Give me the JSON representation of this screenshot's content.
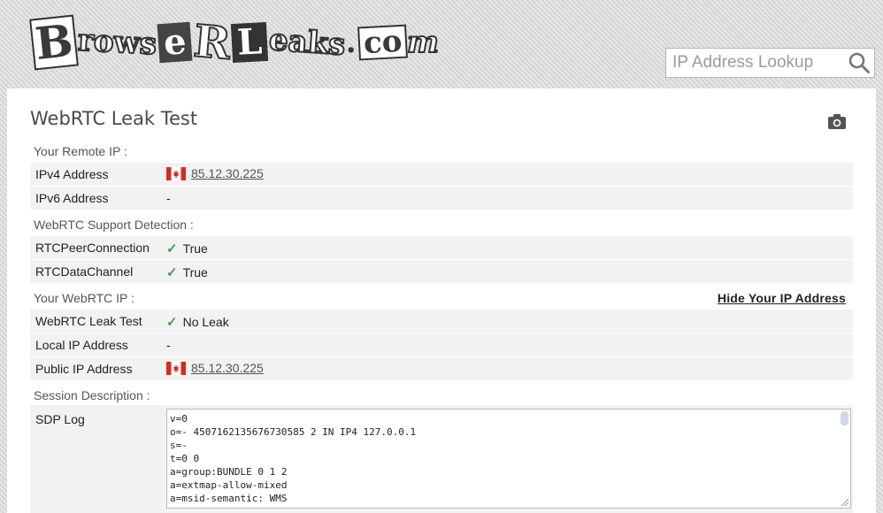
{
  "header": {
    "logo_text": "BrowserLeaks.com",
    "search_placeholder": "IP Address Lookup",
    "search_icon": "magnifier-icon"
  },
  "panel": {
    "title": "WebRTC Leak Test",
    "camera_icon": "camera-icon",
    "sections": {
      "remote_ip": "Your Remote IP :",
      "support": "WebRTC Support Detection :",
      "webrtc_ip": "Your WebRTC IP :",
      "session": "Session Description :"
    },
    "hide_link": "Hide Your IP Address",
    "rows": {
      "ipv4": {
        "label": "IPv4 Address",
        "value": "85.12.30.225",
        "flag": "canada-flag"
      },
      "ipv6": {
        "label": "IPv6 Address",
        "value": "-"
      },
      "peer": {
        "label": "RTCPeerConnection",
        "value": "True"
      },
      "channel": {
        "label": "RTCDataChannel",
        "value": "True"
      },
      "leak": {
        "label": "WebRTC Leak Test",
        "value": "No Leak"
      },
      "local": {
        "label": "Local IP Address",
        "value": "-"
      },
      "public": {
        "label": "Public IP Address",
        "value": "85.12.30.225",
        "flag": "canada-flag"
      },
      "sdp": {
        "label": "SDP Log"
      }
    },
    "check_mark": "✓",
    "sdp_log": "v=0\no=- 4507162135676730585 2 IN IP4 127.0.0.1\ns=-\nt=0 0\na=group:BUNDLE 0 1 2\na=extmap-allow-mixed\na=msid-semantic: WMS"
  },
  "colors": {
    "check": "#3fa34d",
    "row_bg": "#f2f2f2",
    "flag_red": "#d52b1e"
  }
}
